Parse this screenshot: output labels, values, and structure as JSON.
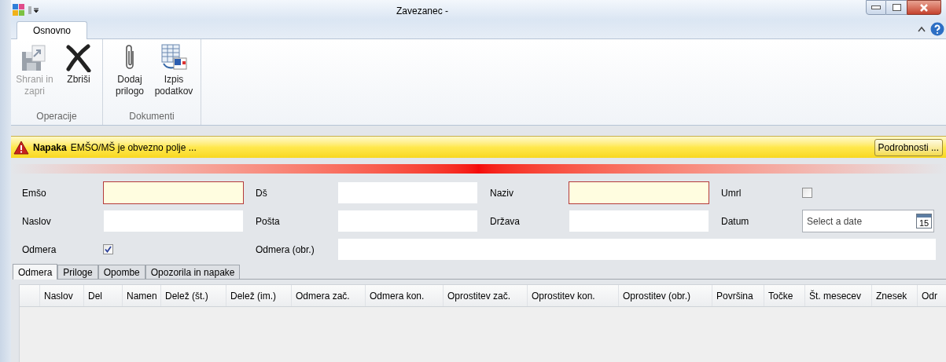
{
  "window": {
    "title": "Zavezanec -"
  },
  "ribbon_tabs": [
    {
      "label": "Osnovno",
      "selected": true
    }
  ],
  "ribbon_groups": [
    {
      "label": "Operacije",
      "buttons": [
        {
          "label": "Shrani in zapri",
          "kind": "save",
          "disabled": true
        },
        {
          "label": "Zbriši",
          "kind": "delete",
          "disabled": false
        }
      ]
    },
    {
      "label": "Dokumenti",
      "buttons": [
        {
          "label": "Dodaj prilogo",
          "kind": "clip",
          "disabled": false
        },
        {
          "label": "Izpis podatkov",
          "kind": "report",
          "disabled": false
        }
      ]
    }
  ],
  "error_bar": {
    "title": "Napaka",
    "message": "EMŠO/MŠ je obvezno polje ...",
    "button": "Podrobnosti ..."
  },
  "form_rows": [
    [
      {
        "label": "Emšo",
        "kind": "text",
        "required": true
      },
      {
        "label": "Dš",
        "kind": "text",
        "required": false
      },
      {
        "label": "Naziv",
        "kind": "text",
        "required": true
      },
      {
        "label": "Umrl",
        "kind": "checkbox",
        "checked": false
      }
    ],
    [
      {
        "label": "Naslov",
        "kind": "text",
        "required": false
      },
      {
        "label": "Pošta",
        "kind": "text",
        "required": false
      },
      {
        "label": "Država",
        "kind": "text",
        "required": false
      },
      {
        "label": "Datum",
        "kind": "date",
        "placeholder": "Select a date",
        "icon_text": "15"
      }
    ],
    [
      {
        "label": "Odmera",
        "kind": "checkbox",
        "checked": true
      },
      {
        "label": "Odmera (obr.)",
        "kind": "wide",
        "required": false
      }
    ]
  ],
  "tabs": [
    {
      "label": "Odmera",
      "selected": true
    },
    {
      "label": "Priloge",
      "selected": false
    },
    {
      "label": "Opombe",
      "selected": false
    },
    {
      "label": "Opozorila in napake",
      "selected": false
    }
  ],
  "table": {
    "columns": [
      "Naslov",
      "Del",
      "Namen",
      "Delež (št.)",
      "Delež (im.)",
      "Odmera zač.",
      "Odmera kon.",
      "Oprostitev zač.",
      "Oprostitev kon.",
      "Oprostitev (obr.)",
      "Površina",
      "Točke",
      "Št. mesecev",
      "Znesek",
      "Odr"
    ]
  }
}
